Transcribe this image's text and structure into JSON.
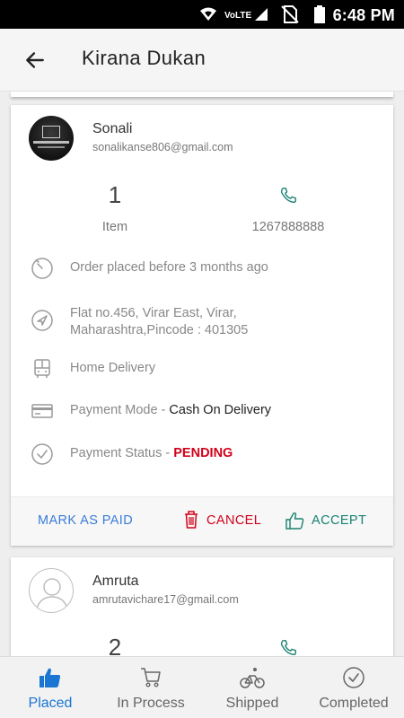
{
  "status_bar": {
    "time": "6:48 PM",
    "network_label": "VoLTE"
  },
  "app_bar": {
    "title": "Kirana Dukan",
    "back_icon": "arrow-back-icon"
  },
  "orders": [
    {
      "customer_name": "Sonali",
      "customer_email": "sonalikanse806@gmail.com",
      "item_count": "1",
      "item_label": "Item",
      "phone": "1267888888",
      "order_time": "Order placed before 3 months ago",
      "address_line1": "Flat no.456, Virar East, Virar,",
      "address_line2": "Maharashtra,Pincode : 401305",
      "delivery_type": "Home Delivery",
      "payment_mode_label": "Payment Mode - ",
      "payment_mode_value": "Cash On Delivery",
      "payment_status_label": "Payment Status - ",
      "payment_status_value": "PENDING",
      "actions": {
        "mark_paid": "MARK AS PAID",
        "cancel": "CANCEL",
        "accept": "ACCEPT"
      }
    },
    {
      "customer_name": "Amruta",
      "customer_email": "amrutavichare17@gmail.com",
      "item_count": "2"
    }
  ],
  "bottom_nav": {
    "items": [
      {
        "label": "Placed",
        "icon": "thumbs-up-icon",
        "active": true
      },
      {
        "label": "In Process",
        "icon": "cart-icon",
        "active": false
      },
      {
        "label": "Shipped",
        "icon": "bicycle-icon",
        "active": false
      },
      {
        "label": "Completed",
        "icon": "check-circle-icon",
        "active": false
      }
    ]
  },
  "colors": {
    "accent_blue": "#1976d2",
    "link_blue": "#3b7dd8",
    "danger_red": "#d0021b",
    "accept_teal": "#17826f"
  }
}
